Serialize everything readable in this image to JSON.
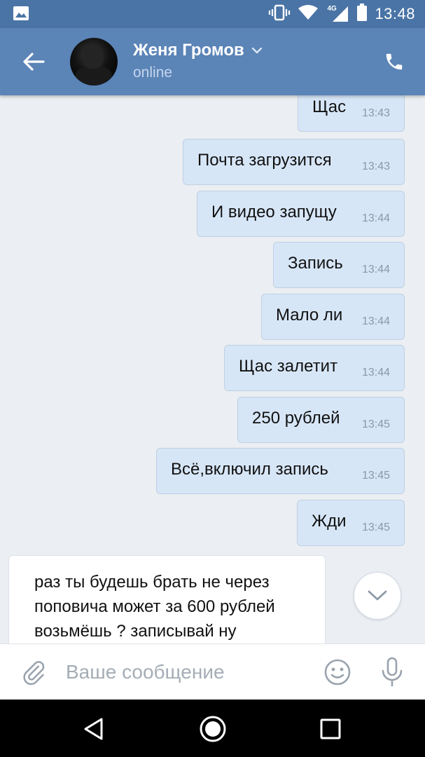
{
  "status_bar": {
    "time": "13:48",
    "network_label": "4G",
    "icons": [
      "gallery-notification-icon",
      "vibrate-icon",
      "wifi-icon",
      "cellular-signal-icon",
      "battery-icon"
    ]
  },
  "header": {
    "contact_name": "Женя Громов",
    "status": "online",
    "icons": [
      "back-arrow-icon",
      "chevron-down-icon",
      "phone-icon"
    ]
  },
  "messages": [
    {
      "direction": "outgoing",
      "text": "Щас",
      "time": "13:43"
    },
    {
      "direction": "outgoing",
      "text": "Почта загрузится",
      "time": "13:43"
    },
    {
      "direction": "outgoing",
      "text": "И видео запущу",
      "time": "13:44"
    },
    {
      "direction": "outgoing",
      "text": "Запись",
      "time": "13:44"
    },
    {
      "direction": "outgoing",
      "text": "Мало ли",
      "time": "13:44"
    },
    {
      "direction": "outgoing",
      "text": "Щас залетит",
      "time": "13:44"
    },
    {
      "direction": "outgoing",
      "text": "250 рублей",
      "time": "13:45"
    },
    {
      "direction": "outgoing",
      "text": "Всё,включил запись",
      "time": "13:45"
    },
    {
      "direction": "outgoing",
      "text": "Жди",
      "time": "13:45"
    },
    {
      "direction": "incoming",
      "text": "раз ты будешь брать не через поповича может за 600 рублей возьмёшь ? записывай ну"
    }
  ],
  "composer": {
    "placeholder": "Ваше сообщение",
    "value": "",
    "icons": [
      "paperclip-icon",
      "emoji-icon",
      "microphone-icon"
    ]
  },
  "nav_bar": {
    "icons": [
      "nav-back-icon",
      "nav-home-icon",
      "nav-recents-icon"
    ]
  },
  "colors": {
    "status_bar": "#4a74a6",
    "app_bar": "#5b84b7",
    "chat_background": "#ebeef2",
    "outgoing_bubble": "#d7e6f7",
    "incoming_bubble": "#ffffff"
  }
}
